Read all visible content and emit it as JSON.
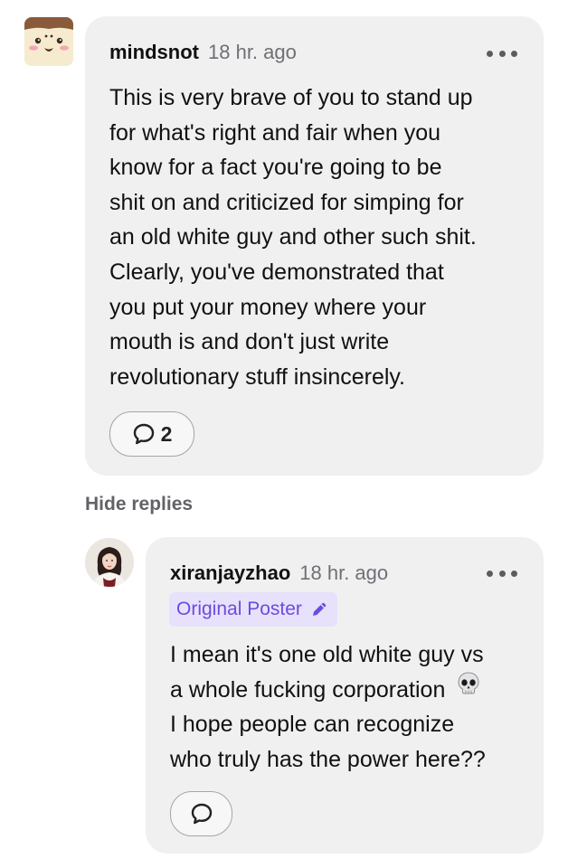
{
  "comment": {
    "username": "mindsnot",
    "timestamp": "18 hr. ago",
    "more_icon": "more-horizontal-icon",
    "body_lines": [
      "This is very brave of you to stand up",
      "for what's right and fair when you",
      "know for a fact you're going to be",
      "shit on and criticized for simping for",
      "an old white guy and other such shit.",
      "Clearly, you've demonstrated that",
      "you put your money where your",
      "mouth is and don't just write",
      "revolutionary stuff insincerely."
    ],
    "reply_icon": "speech-bubble-icon",
    "reply_count": "2"
  },
  "thread": {
    "hide_replies_label": "Hide replies"
  },
  "reply": {
    "username": "xiranjayzhao",
    "timestamp": "18 hr. ago",
    "more_icon": "more-horizontal-icon",
    "badge_label": "Original Poster",
    "badge_icon": "pencil-icon",
    "body_lines": [
      "I mean it's one old white guy vs",
      "a whole fucking corporation",
      "I hope people can recognize",
      "who truly has the power here??"
    ],
    "emoji": "skull-emoji",
    "reply_icon": "speech-bubble-icon"
  },
  "colors": {
    "card_bg": "#f0f0f1",
    "badge_bg": "#e8e1fb",
    "badge_text": "#6c4bde",
    "muted_text": "#6f6f75"
  }
}
